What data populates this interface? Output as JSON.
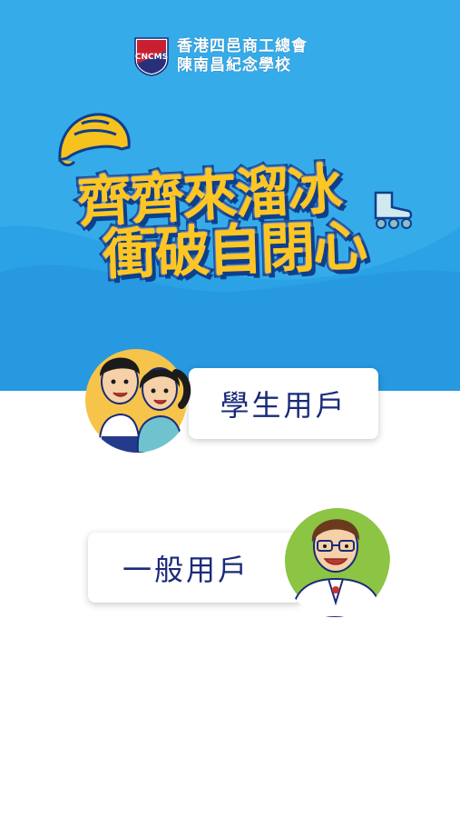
{
  "header": {
    "school_name_line1": "香港四邑商工總會",
    "school_name_line2": "陳南昌紀念學校",
    "logo_letters": "CNCMS"
  },
  "banner": {
    "title_line1": "齊齊來溜冰",
    "title_line2": "衝破自閉心"
  },
  "options": {
    "student_label": "學生用戶",
    "general_label": "一般用戶"
  },
  "colors": {
    "sky_blue": "#2ba2e6",
    "title_yellow": "#ffc623",
    "title_outline": "#0e3f8c",
    "label_navy": "#1a2a78"
  }
}
